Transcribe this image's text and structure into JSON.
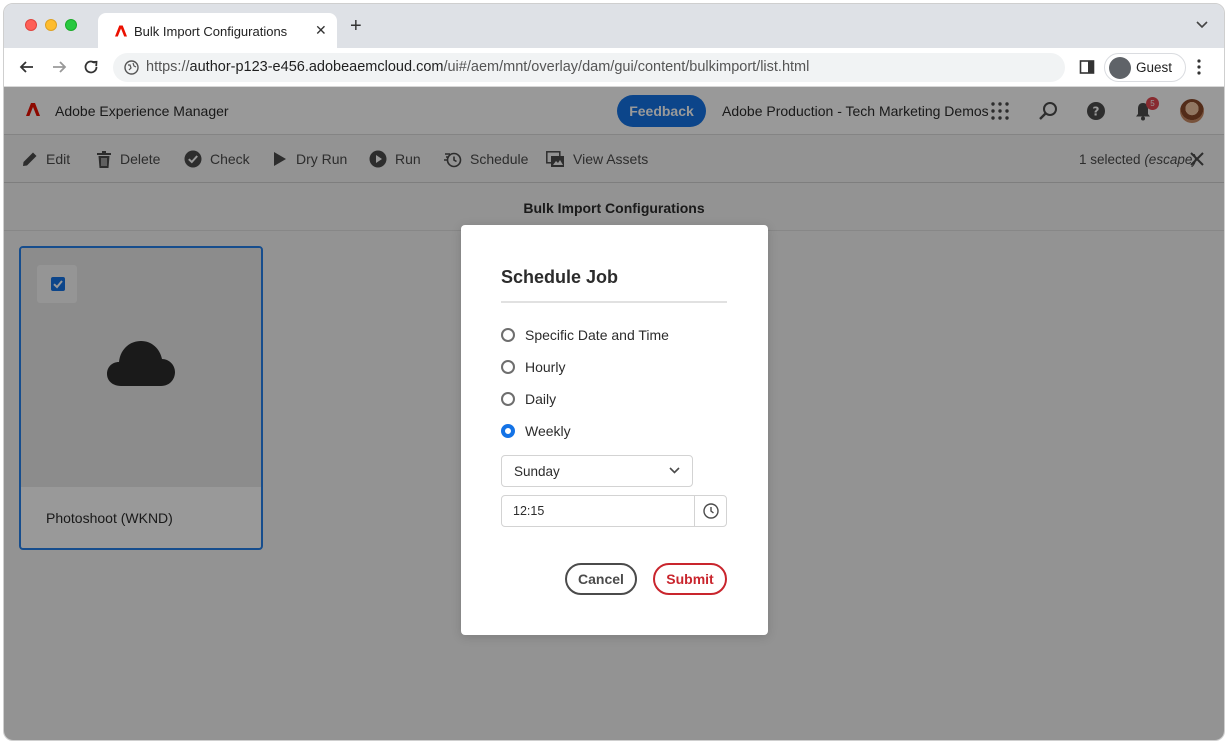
{
  "browser": {
    "tab_title": "Bulk Import Configurations",
    "url_scheme": "https://",
    "url_host": "author-p123-e456.adobeaemcloud.com",
    "url_path": "/ui#/aem/mnt/overlay/dam/gui/content/bulkimport/list.html",
    "profile_label": "Guest"
  },
  "header": {
    "app_title": "Adobe Experience Manager",
    "feedback_label": "Feedback",
    "org_name": "Adobe Production - Tech Marketing Demos",
    "notification_count": "5",
    "brand_color": "#eb1000",
    "accent_color": "#1473e6"
  },
  "actions": {
    "items": [
      {
        "label": "Edit",
        "icon": "pencil-icon"
      },
      {
        "label": "Delete",
        "icon": "trash-icon"
      },
      {
        "label": "Check",
        "icon": "checkmark-circle-icon"
      },
      {
        "label": "Dry Run",
        "icon": "play-icon"
      },
      {
        "label": "Run",
        "icon": "play-circle-icon"
      },
      {
        "label": "Schedule",
        "icon": "schedule-icon"
      },
      {
        "label": "View Assets",
        "icon": "images-icon"
      }
    ],
    "selection_count": "1 selected",
    "selection_hint": "(escape)"
  },
  "content": {
    "title": "Bulk Import Configurations",
    "cards": [
      {
        "label": "Photoshoot (WKND)",
        "selected": true,
        "icon": "cloud-icon"
      }
    ]
  },
  "dialog": {
    "title": "Schedule Job",
    "options": [
      {
        "label": "Specific Date and Time",
        "selected": false
      },
      {
        "label": "Hourly",
        "selected": false
      },
      {
        "label": "Daily",
        "selected": false
      },
      {
        "label": "Weekly",
        "selected": true
      }
    ],
    "day_value": "Sunday",
    "time_value": "12:15",
    "cancel_label": "Cancel",
    "submit_label": "Submit",
    "submit_color": "#c9252d"
  }
}
